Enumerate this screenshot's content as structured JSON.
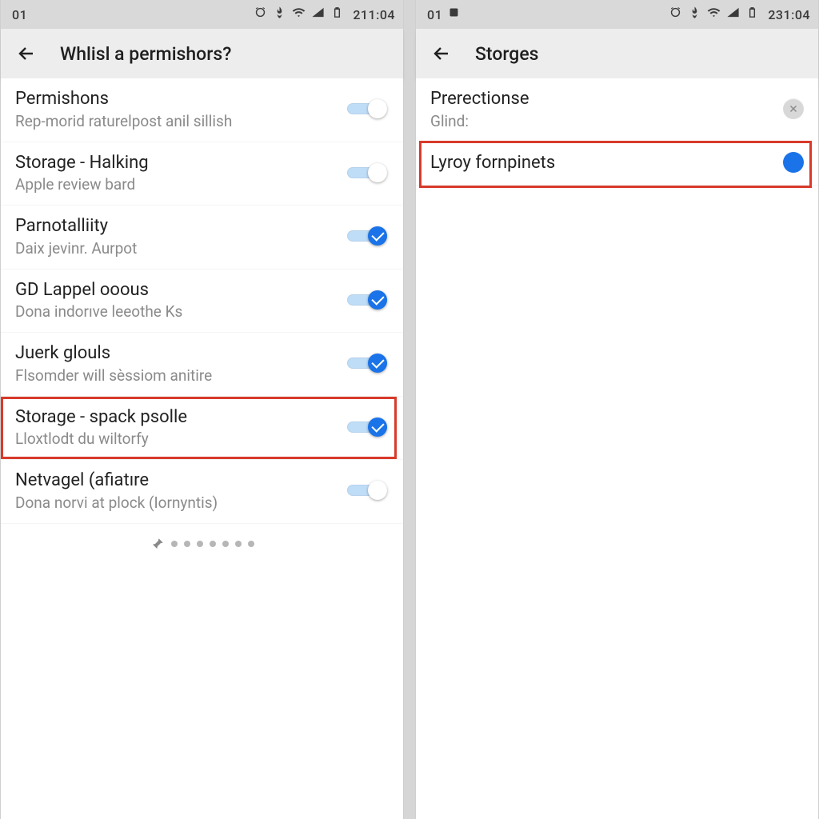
{
  "left": {
    "statusbar": {
      "clock_left": "01",
      "time": "211:04"
    },
    "appbar": {
      "title": "Whlisl a permishors?"
    },
    "items": [
      {
        "title": "Permishons",
        "sub": "Rep-morid raturelpost anil sillish",
        "ctrl": "switch_on_white"
      },
      {
        "title": "Storage - Halking",
        "sub": "Apple review bard",
        "ctrl": "switch_on_white"
      },
      {
        "title": "Parnotalliity",
        "sub": "Daix jevinr. Aurpot",
        "ctrl": "switch_check"
      },
      {
        "title": "GD Lappel ooous",
        "sub": "Dona indorıve leeothe Ks",
        "ctrl": "switch_check"
      },
      {
        "title": "Juerk glouls",
        "sub": "Flsomder will sèssiom anitire",
        "ctrl": "switch_check"
      },
      {
        "title": "Storage - spack psolle",
        "sub": "Lloxtlodt du wiltorfy",
        "ctrl": "switch_check",
        "highlight": true
      },
      {
        "title": "Netvagel (afiatıre",
        "sub": "Dona norvi at plock (Iornyntis)",
        "ctrl": "switch_on_white"
      }
    ],
    "dots_count": 7
  },
  "right": {
    "statusbar": {
      "clock_left": "01",
      "time": "231:04"
    },
    "appbar": {
      "title": "Storges"
    },
    "items": [
      {
        "title": "Prerectionse",
        "sub": "Glind:",
        "ctrl": "close"
      },
      {
        "title": "Lyroy fornpinets",
        "sub": "",
        "ctrl": "radio",
        "highlight": true
      }
    ]
  }
}
